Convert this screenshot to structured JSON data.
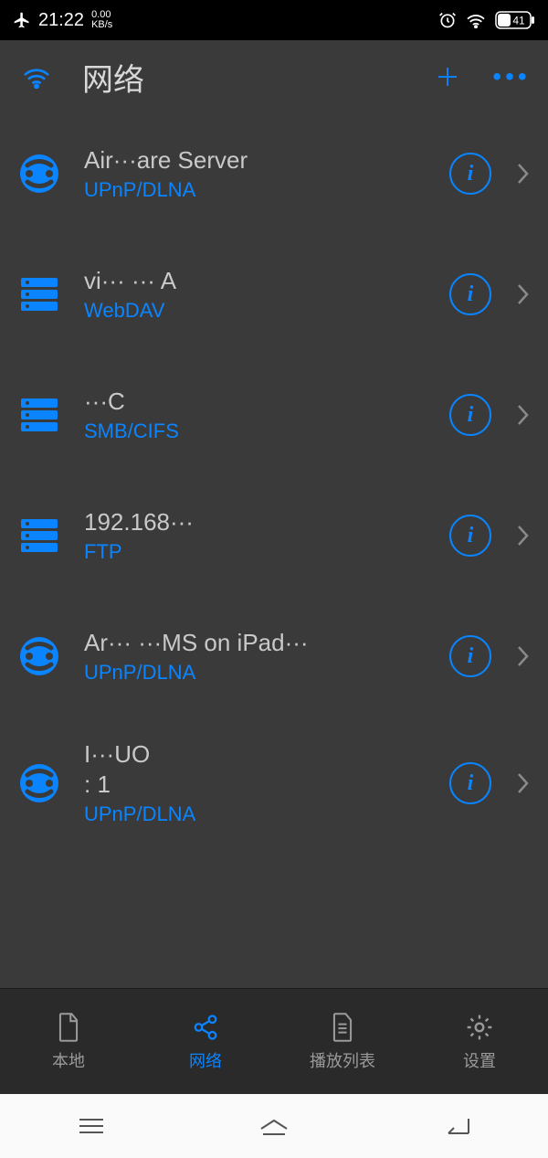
{
  "statusbar": {
    "time": "21:22",
    "speed_top": "0.00",
    "speed_bottom": "KB/s",
    "battery": "41"
  },
  "header": {
    "title": "网络"
  },
  "items": [
    {
      "title": "Air···are Server",
      "subtitle": "",
      "protocol": "UPnP/DLNA",
      "icon": "dlna"
    },
    {
      "title": "vi··· ··· A",
      "subtitle": "",
      "protocol": "WebDAV",
      "icon": "server"
    },
    {
      "title": "···C",
      "subtitle": "",
      "protocol": "SMB/CIFS",
      "icon": "server"
    },
    {
      "title": "192.168···",
      "subtitle": "",
      "protocol": "FTP",
      "icon": "server"
    },
    {
      "title": "Ar··· ···MS on iPad···",
      "subtitle": "",
      "protocol": "UPnP/DLNA",
      "icon": "dlna"
    },
    {
      "title": "I···UO",
      "subtitle": ": 1",
      "protocol": "UPnP/DLNA",
      "icon": "dlna"
    }
  ],
  "info_label": "i",
  "tabs": {
    "local": "本地",
    "network": "网络",
    "playlist": "播放列表",
    "settings": "设置"
  },
  "colors": {
    "accent": "#0a84ff"
  }
}
